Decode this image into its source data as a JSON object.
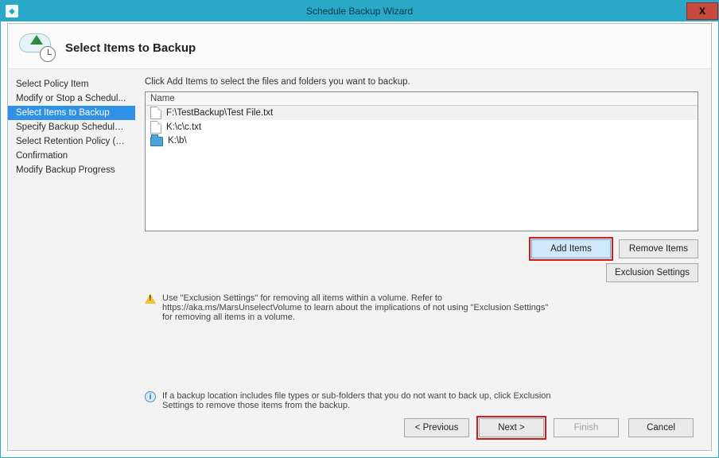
{
  "window": {
    "title": "Schedule Backup Wizard",
    "close_glyph": "X"
  },
  "page": {
    "heading": "Select Items to Backup",
    "instruction": "Click Add Items to select the files and folders you want to backup."
  },
  "sidebar": {
    "steps": [
      {
        "label": "Select Policy Item"
      },
      {
        "label": "Modify or Stop a Schedul..."
      },
      {
        "label": "Select Items to Backup"
      },
      {
        "label": "Specify Backup Schedule ..."
      },
      {
        "label": "Select Retention Policy (F..."
      },
      {
        "label": "Confirmation"
      },
      {
        "label": "Modify Backup Progress"
      }
    ],
    "active_index": 2
  },
  "list": {
    "header": "Name",
    "items": [
      {
        "label": "F:\\TestBackup\\Test File.txt",
        "icon": "file"
      },
      {
        "label": "K:\\c\\c.txt",
        "icon": "file"
      },
      {
        "label": "K:\\b\\",
        "icon": "folder"
      }
    ],
    "selected_index": 0
  },
  "buttons": {
    "add_items": "Add Items",
    "remove_items": "Remove Items",
    "exclusion_settings": "Exclusion Settings",
    "previous": "< Previous",
    "next": "Next >",
    "finish": "Finish",
    "cancel": "Cancel"
  },
  "notes": {
    "warning": "Use \"Exclusion Settings\" for removing all items within a volume. Refer to https://aka.ms/MarsUnselectVolume to learn about the implications of not using \"Exclusion Settings\" for removing all items in a volume.",
    "info": "If a backup location includes file types or sub-folders that you do not want to back up, click Exclusion Settings to remove those items from the backup."
  }
}
